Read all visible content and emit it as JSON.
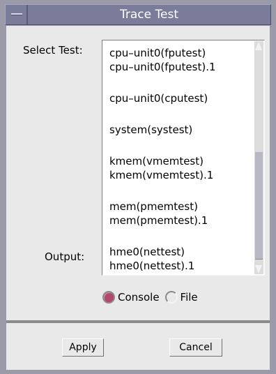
{
  "window": {
    "title": "Trace Test"
  },
  "labels": {
    "select_test": "Select Test:",
    "output": "Output:"
  },
  "test_list": {
    "items": [
      "cpu–unit0(fputest)",
      "cpu–unit0(fputest).1",
      "",
      "cpu–unit0(cputest)",
      "",
      "system(systest)",
      "",
      "kmem(vmemtest)",
      "kmem(vmemtest).1",
      "",
      "mem(pmemtest)",
      "mem(pmemtest).1",
      "",
      "hme0(nettest)",
      "hme0(nettest).1"
    ]
  },
  "output": {
    "options": [
      {
        "label": "Console",
        "selected": true
      },
      {
        "label": "File",
        "selected": false
      }
    ]
  },
  "buttons": {
    "apply": "Apply",
    "cancel": "Cancel"
  },
  "colors": {
    "titlebar": "#7b7c9a",
    "radio_selected": "#b04a6c",
    "dialog_bg": "#e9e9e9"
  }
}
